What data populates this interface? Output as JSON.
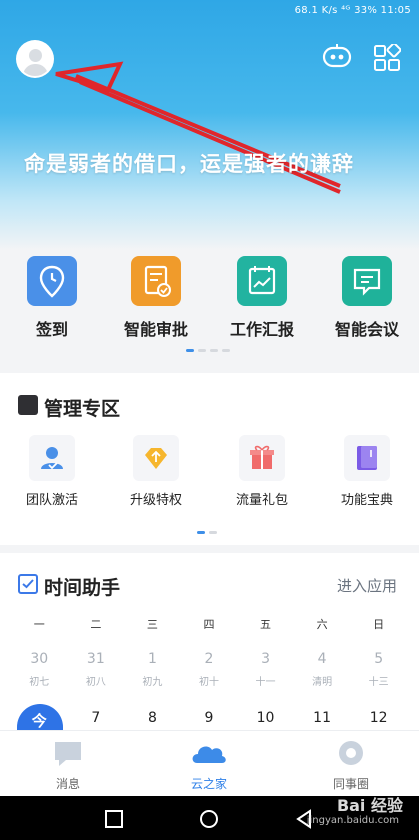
{
  "status_bar": {
    "text": "68.1 K/s  ⁴ᴳ 33%   11:05"
  },
  "header": {
    "slogan": "命是弱者的借口，运是强者的谦辞",
    "icons": [
      "avatar",
      "robot-icon",
      "grid-icon"
    ]
  },
  "quick_apps": [
    {
      "label": "签到",
      "icon": "location-clock-icon",
      "color": "#4a90e8"
    },
    {
      "label": "智能审批",
      "icon": "document-check-icon",
      "color": "#f09b2b"
    },
    {
      "label": "工作汇报",
      "icon": "chart-calendar-icon",
      "color": "#22b3a0"
    },
    {
      "label": "智能会议",
      "icon": "chat-icon",
      "color": "#1fb29a"
    }
  ],
  "management": {
    "title": "管理专区",
    "items": [
      {
        "label": "团队激活",
        "icon": "team-user-icon"
      },
      {
        "label": "升级特权",
        "icon": "upgrade-diamond-icon"
      },
      {
        "label": "流量礼包",
        "icon": "gift-icon"
      },
      {
        "label": "功能宝典",
        "icon": "book-icon"
      }
    ]
  },
  "time_assistant": {
    "title": "时间助手",
    "enter_label": "进入应用",
    "weekdays": [
      "一",
      "二",
      "三",
      "四",
      "五",
      "六",
      "日"
    ],
    "row1_dates": [
      "30",
      "31",
      "1",
      "2",
      "3",
      "4",
      "5"
    ],
    "row1_lunar": [
      "初七",
      "初八",
      "初九",
      "初十",
      "十一",
      "清明",
      "十三"
    ],
    "row2_dates": [
      "今",
      "7",
      "8",
      "9",
      "10",
      "11",
      "12"
    ]
  },
  "tabbar": [
    {
      "label": "消息",
      "icon": "message-icon",
      "active": false
    },
    {
      "label": "云之家",
      "icon": "cloud-icon",
      "active": true
    },
    {
      "label": "同事圈",
      "icon": "circle-icon",
      "active": false
    }
  ],
  "watermark": {
    "text": "Bai 经验",
    "sub": "jingyan.baidu.com"
  }
}
